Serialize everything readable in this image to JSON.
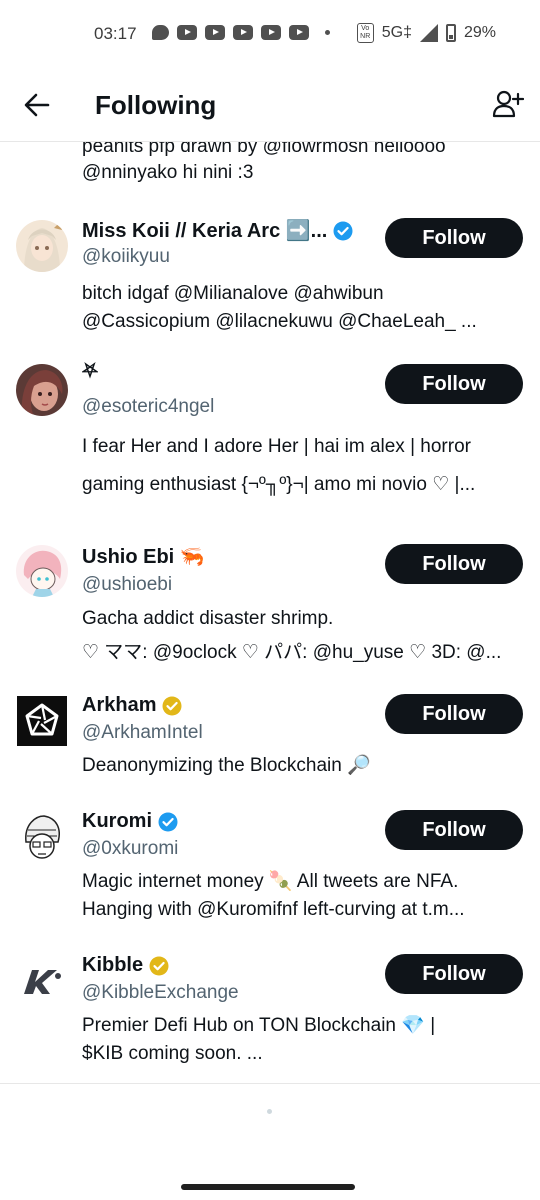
{
  "status_bar": {
    "time": "03:17",
    "network": "5G‡",
    "volte": "Vo NR",
    "battery": "29%"
  },
  "header": {
    "title": "Following",
    "back_icon": "arrow-left-icon",
    "add_icon": "add-user-icon"
  },
  "top_bio_fragment": [
    "peanits pfp drawn by @flowrmosh helloooo",
    "@nninyako hi nini :3"
  ],
  "colors": {
    "verified_blue": "#1d9bf0",
    "verified_gold": "#e2b719",
    "button_bg": "#0f1419",
    "handle": "#536471"
  },
  "follow_label": "Follow",
  "users": [
    {
      "name": "Miss Koii // Keria Arc ➡️...",
      "handle": "@koiikyuu",
      "verified": "blue",
      "bio": [
        "bitch idgaf @Milianalove @ahwibun",
        "@Cassicopium @lilacnekuwu @ChaeLeah_ ..."
      ]
    },
    {
      "name": "⛧",
      "handle": "@esoteric4ngel",
      "verified": "none",
      "bio": [
        "I fear Her and I adore Her | hai im alex | horror",
        "gaming enthusiast {¬º╖º}¬| amo mi novio ♡ |..."
      ]
    },
    {
      "name": "Ushio Ebi 🦐",
      "handle": "@ushioebi",
      "verified": "none",
      "bio": [
        "Gacha addict disaster shrimp.",
        "♡ ママ: @9oclock ♡ パパ: @hu_yuse ♡ 3D: @..."
      ]
    },
    {
      "name": "Arkham",
      "handle": "@ArkhamIntel",
      "verified": "gold",
      "bio": [
        "Deanonymizing the Blockchain 🔎"
      ]
    },
    {
      "name": "Kuromi",
      "handle": "@0xkuromi",
      "verified": "blue",
      "bio": [
        "Magic internet money 🍡 All tweets are NFA.",
        "Hanging with @Kuromifnf left-curving at t.m..."
      ]
    },
    {
      "name": "Kibble",
      "handle": "@KibbleExchange",
      "verified": "gold",
      "bio": [
        "Premier Defi Hub on TON Blockchain 💎 |",
        "$KIB coming soon. ..."
      ]
    }
  ]
}
